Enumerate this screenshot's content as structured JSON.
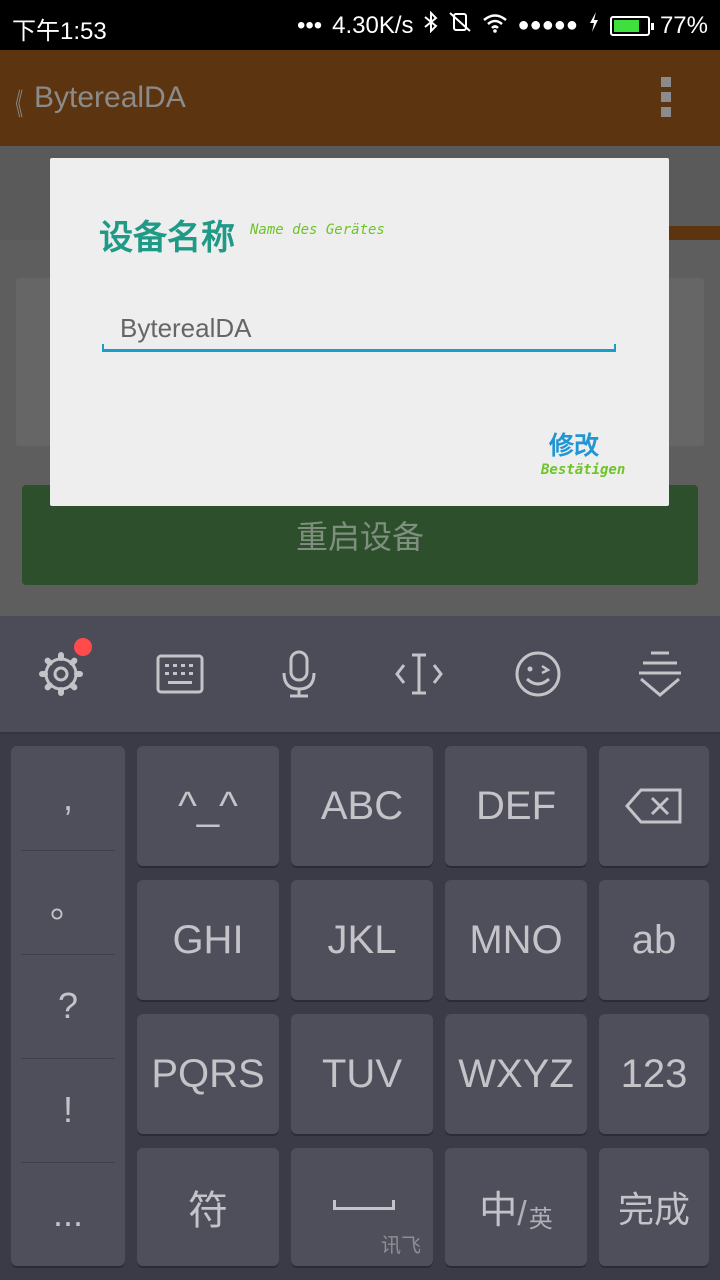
{
  "status_bar": {
    "time": "下午1:53",
    "dots": "•••",
    "speed": "4.30K/s",
    "signal": "●●●●●",
    "battery_percent": "77%",
    "battery_level": 0.77
  },
  "app_bar": {
    "back_glyph": "《",
    "title": "ByterealDA"
  },
  "background": {
    "restart_button": "重启设备"
  },
  "dialog": {
    "title": "设备名称",
    "title_sub": "Name des Gerätes",
    "input_value": "ByterealDA",
    "confirm_label": "修改",
    "confirm_sub": "Bestätigen"
  },
  "keyboard": {
    "punctuation": [
      ",",
      "。",
      "?",
      "!",
      "..."
    ],
    "rows": [
      [
        "^_^",
        "ABC",
        "DEF"
      ],
      [
        "GHI",
        "JKL",
        "MNO"
      ],
      [
        "PQRS",
        "TUV",
        "WXYZ"
      ]
    ],
    "right_col": [
      "ab",
      "123",
      "完成"
    ],
    "symbol_key": "符",
    "space_brand": "讯飞",
    "lang_key_main": "中",
    "lang_key_sub": "英"
  }
}
